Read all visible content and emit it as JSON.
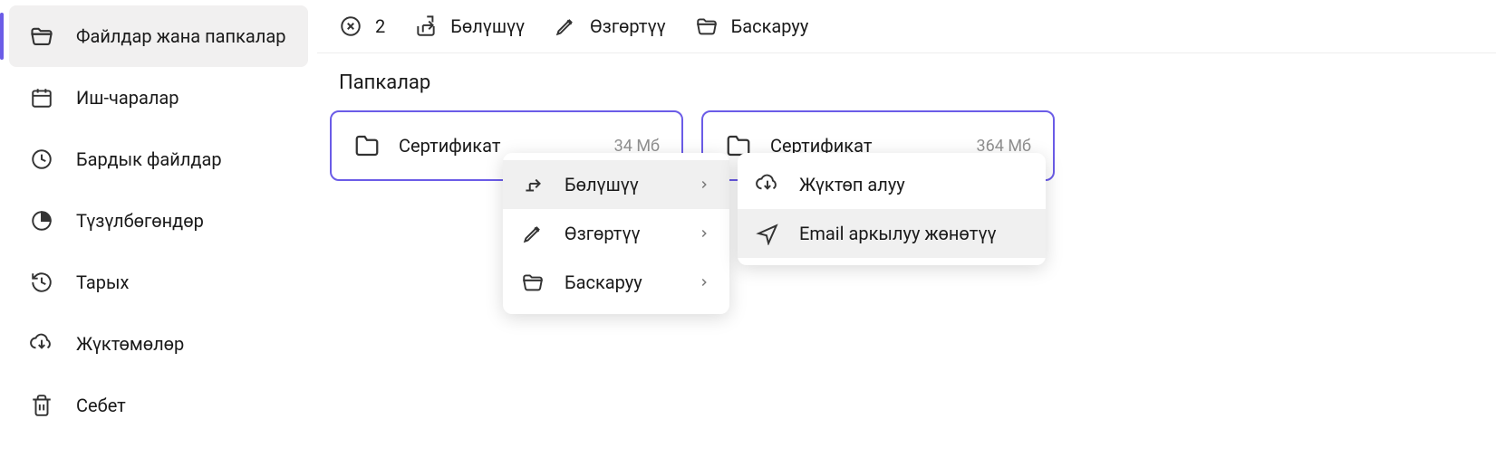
{
  "sidebar": {
    "items": [
      {
        "label": "Файлдар жана папкалар",
        "icon": "folder-open"
      },
      {
        "label": "Иш-чаралар",
        "icon": "calendar"
      },
      {
        "label": "Бардык файлдар",
        "icon": "clock"
      },
      {
        "label": "Түзүлбөгөндөр",
        "icon": "pie"
      },
      {
        "label": "Тарых",
        "icon": "history"
      },
      {
        "label": "Жүктөмөлөр",
        "icon": "download"
      },
      {
        "label": "Себет",
        "icon": "trash"
      }
    ]
  },
  "toolbar": {
    "count": "2",
    "share": "Бөлүшүү",
    "edit": "Өзгөртүү",
    "manage": "Баскаруу"
  },
  "content": {
    "section_title": "Папкалар",
    "folders": [
      {
        "name": "Сертификат",
        "size": "34 Мб"
      },
      {
        "name": "Сертификат",
        "size": "364 Мб"
      }
    ]
  },
  "context_menu": {
    "items": [
      {
        "label": "Бөлүшүү"
      },
      {
        "label": "Өзгөртүү"
      },
      {
        "label": "Баскаруу"
      }
    ]
  },
  "submenu": {
    "items": [
      {
        "label": "Жүктөп алуу"
      },
      {
        "label": "Email аркылуу жөнөтүү"
      }
    ]
  }
}
